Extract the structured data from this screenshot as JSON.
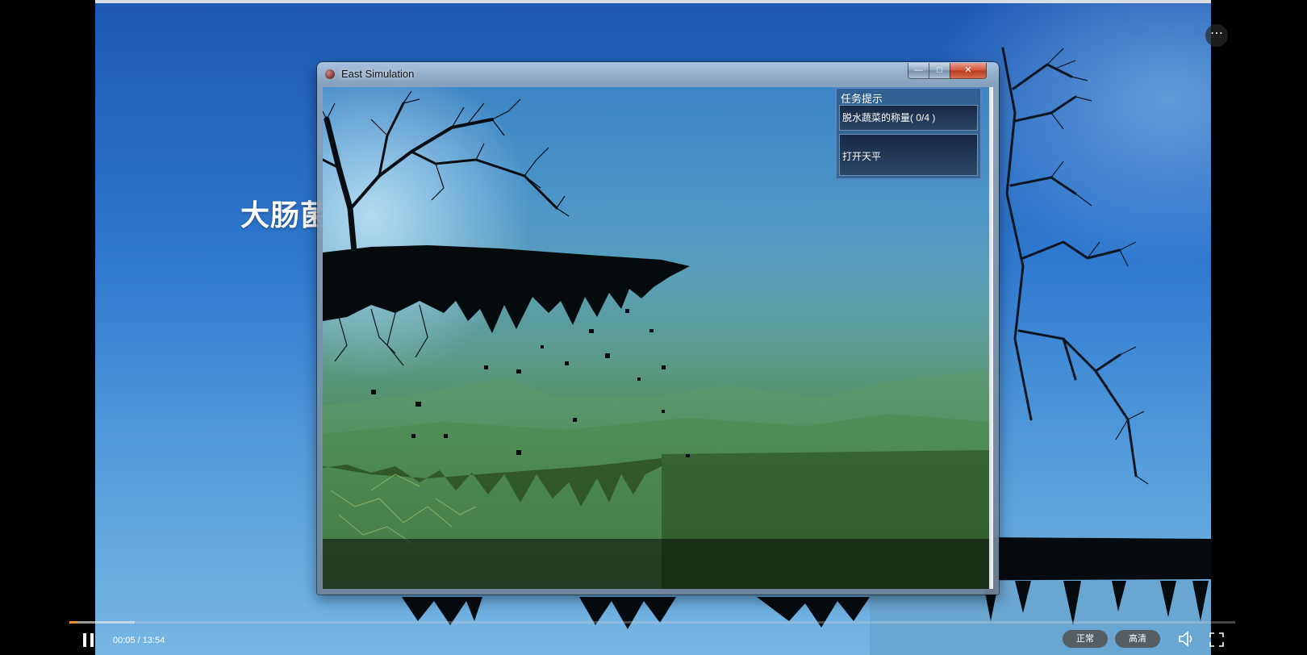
{
  "slide": {
    "title_fragment": "大肠菌"
  },
  "window": {
    "title": "East Simulation",
    "minimize_glyph": "—",
    "maximize_glyph": "□",
    "close_glyph": "✕"
  },
  "quest_panel": {
    "title": "任务提示",
    "tasks": [
      {
        "text": "脱水蔬菜的称量( 0/4 )"
      },
      {
        "text": "打开天平"
      }
    ]
  },
  "player": {
    "time_display": "00:05 / 13:54",
    "progress": {
      "played_fraction": 0.006,
      "buffered_fraction": 0.056
    },
    "speed_label": "正常",
    "quality_label": "高清",
    "more_glyph": "⋯",
    "icons": [
      "pause-icon",
      "volume-icon",
      "fullscreen-icon",
      "more-icon"
    ],
    "accent_color": "#f08a2c"
  }
}
